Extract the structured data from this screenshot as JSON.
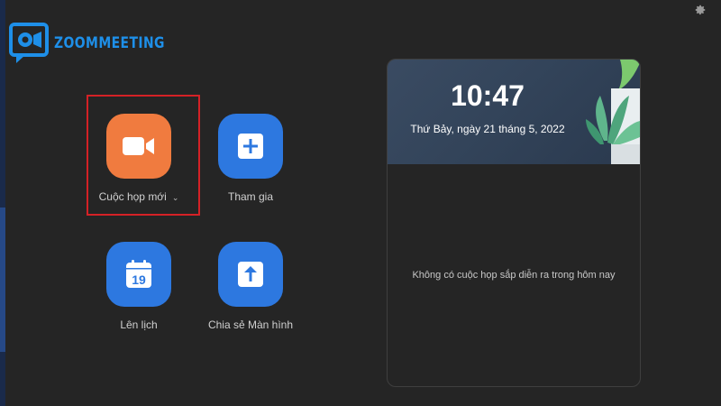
{
  "brand": {
    "name": "ZOOMMEETING",
    "logo_icon": "video-chat-logo-icon"
  },
  "toolbar": {
    "settings_icon": "gear-icon"
  },
  "actions": [
    {
      "label": "Cuộc họp mới",
      "icon": "video-camera-icon",
      "color": "#f07b3f",
      "has_dropdown": true
    },
    {
      "label": "Tham gia",
      "icon": "plus-icon",
      "color": "#2d78e0"
    },
    {
      "label": "Lên lịch",
      "icon": "calendar-icon",
      "color": "#2d78e0",
      "calendar_day": "19"
    },
    {
      "label": "Chia sẻ Màn hình",
      "icon": "share-screen-arrow-icon",
      "color": "#2d78e0"
    }
  ],
  "highlight_color": "#d42126",
  "panel": {
    "time": "10:47",
    "date": "Thứ Bảy, ngày 21 tháng 5, 2022",
    "empty_message": "Không có cuộc họp sắp diễn ra trong hôm nay"
  }
}
